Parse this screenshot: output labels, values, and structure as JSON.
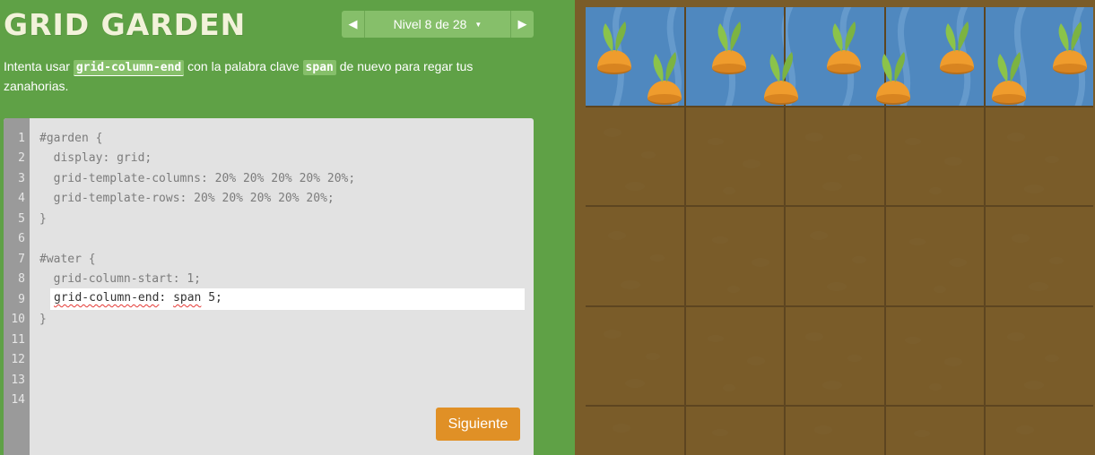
{
  "app": {
    "title": "GRID GARDEN"
  },
  "level_nav": {
    "prev_icon": "triangle-left-icon",
    "label": "Nivel 8 de 28",
    "caret_icon": "chevron-down-icon",
    "next_icon": "triangle-right-icon"
  },
  "instructions": {
    "before": "Intenta usar ",
    "keyword1": "grid-column-end",
    "middle": " con la palabra clave ",
    "keyword2": "span",
    "after": " de nuevo para regar tus zanahorias."
  },
  "editor": {
    "line_numbers": [
      "1",
      "2",
      "3",
      "4",
      "5",
      "6",
      "7",
      "8",
      "9",
      "10",
      "11",
      "12",
      "13",
      "14"
    ],
    "lines": [
      "#garden {",
      "  display: grid;",
      "  grid-template-columns: 20% 20% 20% 20% 20%;",
      "  grid-template-rows: 20% 20% 20% 20% 20%;",
      "}",
      "",
      "#water {",
      "  grid-column-start: 1;",
      "",
      "}",
      "",
      "",
      "",
      ""
    ],
    "input_property": "grid-column-end",
    "input_separator": ": ",
    "input_value_keyword": "span",
    "input_value_rest": " 5;",
    "next_button_label": "Siguiente"
  },
  "garden": {
    "columns": 5,
    "rows": 5,
    "water_cells": "row 1, columns 1-5",
    "carrot_count": 10
  },
  "colors": {
    "background": "#5fa146",
    "accent_button": "#e09026",
    "water": "#4f88bf",
    "soil": "#8a6a33",
    "board_frame": "#7a5c29",
    "carrot": "#ef9c2d",
    "sprout": "#8bc34a"
  }
}
